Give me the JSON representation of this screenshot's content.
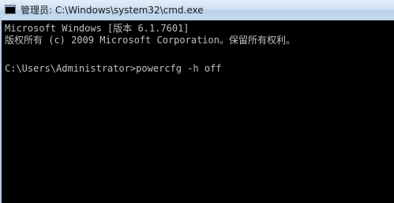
{
  "window": {
    "icon": "cmd-icon",
    "title": "管理员: C:\\Windows\\system32\\cmd.exe"
  },
  "console": {
    "lines": [
      "Microsoft Windows [版本 6.1.7601]",
      "版权所有 (c) 2009 Microsoft Corporation。保留所有权利。",
      "C:\\Users\\Administrator>powercfg -h off"
    ]
  },
  "colors": {
    "titlebar": "#cfe0f2",
    "console_bg": "#000000",
    "console_text": "#c0c0c0"
  }
}
